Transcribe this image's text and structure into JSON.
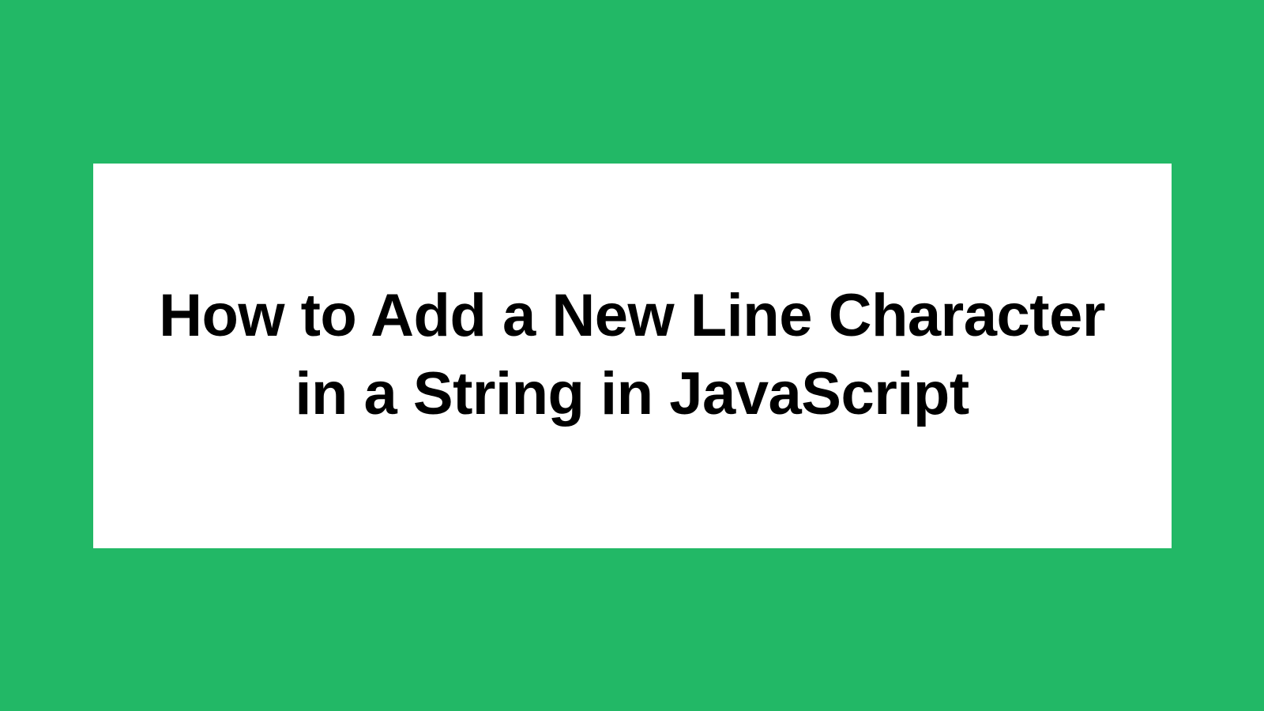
{
  "card": {
    "title": "How to Add a New Line Character in a String in JavaScript"
  },
  "colors": {
    "background": "#22b866",
    "card_background": "#ffffff",
    "text": "#000000"
  }
}
